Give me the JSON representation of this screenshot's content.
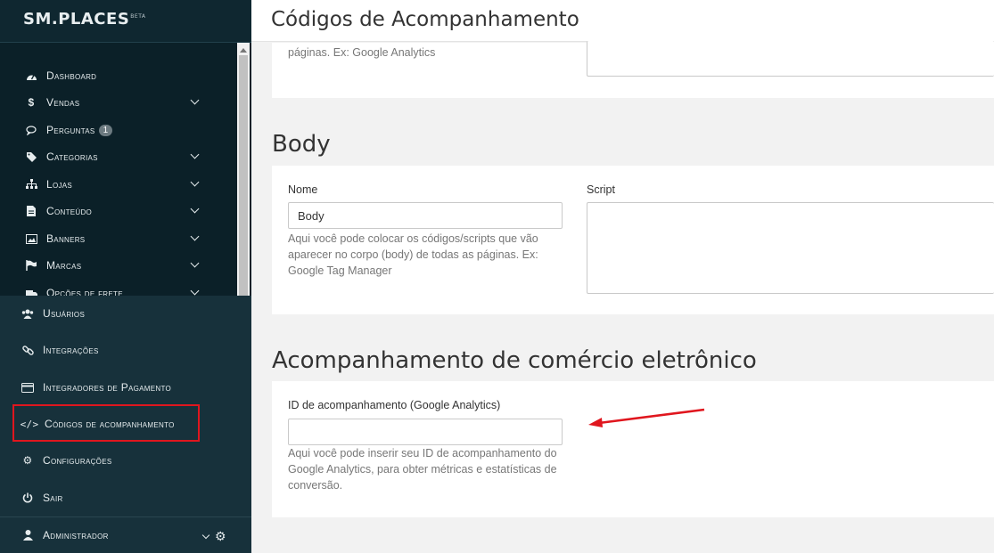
{
  "app": {
    "logo_text": "SM.PLACES",
    "logo_badge": "BETA"
  },
  "page": {
    "title": "Códigos de Acompanhamento"
  },
  "sidebar": {
    "items": [
      {
        "label": "Dashboard",
        "icon": "dashboard-icon"
      },
      {
        "label": "Vendas",
        "icon": "dollar-icon"
      },
      {
        "label": "Perguntas",
        "icon": "comments-icon",
        "badge": "1"
      },
      {
        "label": "Categorias",
        "icon": "tags-icon"
      },
      {
        "label": "Lojas",
        "icon": "sitemap-icon"
      },
      {
        "label": "Conteúdo",
        "icon": "file-icon"
      },
      {
        "label": "Banners",
        "icon": "image-icon"
      },
      {
        "label": "Marcas",
        "icon": "flag-icon"
      },
      {
        "label": "Opções de frete",
        "icon": "truck-icon"
      }
    ],
    "lower_items": [
      {
        "label": "Usuários",
        "icon": "users-icon"
      },
      {
        "label": "Integrações",
        "icon": "link-icon"
      },
      {
        "label": "Integradores de Pagamento",
        "icon": "credit-card-icon"
      },
      {
        "label": "Códigos de acompanhamento",
        "icon": "code-icon"
      },
      {
        "label": "Configurações",
        "icon": "gear-icon"
      },
      {
        "label": "Sair",
        "icon": "power-icon"
      }
    ],
    "admin_label": "Administrador"
  },
  "head_section": {
    "help_tail": "páginas. Ex: Google Analytics"
  },
  "body_section": {
    "title": "Body",
    "name_label": "Nome",
    "name_value": "Body",
    "script_label": "Script",
    "help": "Aqui você pode colocar os códigos/scripts que vão aparecer no corpo (body) de todas as páginas. Ex: Google Tag Manager"
  },
  "ecommerce_section": {
    "title": "Acompanhamento de comércio eletrônico",
    "id_label": "ID de acompanhamento (Google Analytics)",
    "id_value": "",
    "help": "Aqui você pode inserir seu ID de acompanhamento do Google Analytics, para obter métricas e estatísticas de conversão."
  },
  "colors": {
    "sidebar_bg": "#0f2730",
    "highlight": "#e0161e",
    "arrow": "#e0161e"
  }
}
